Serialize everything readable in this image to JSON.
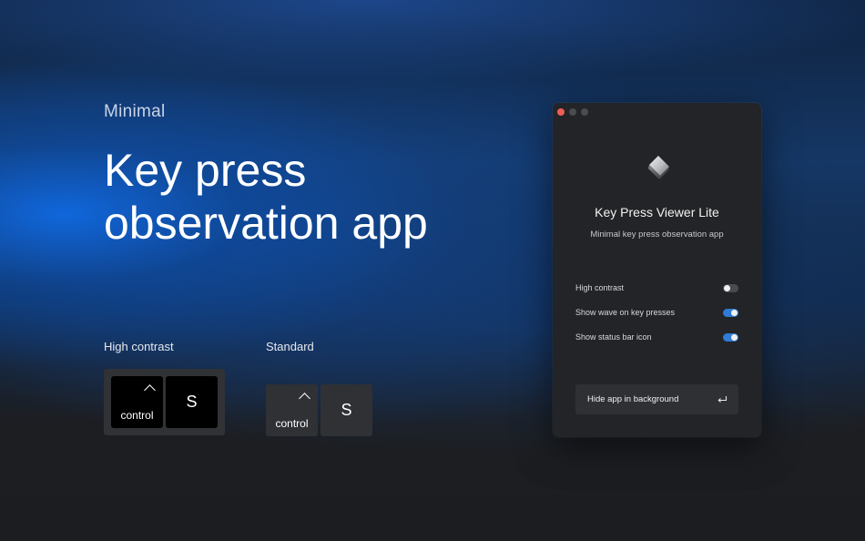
{
  "hero": {
    "subtitle": "Minimal",
    "headline_line1": "Key press",
    "headline_line2": "observation app"
  },
  "demo": {
    "high_contrast": {
      "label": "High contrast",
      "keys": [
        {
          "symbol": "^",
          "word": "control"
        },
        {
          "letter": "S"
        }
      ]
    },
    "standard": {
      "label": "Standard",
      "keys": [
        {
          "symbol": "^",
          "word": "control"
        },
        {
          "letter": "S"
        }
      ]
    }
  },
  "window": {
    "app_name": "Key Press Viewer Lite",
    "app_description": "Minimal key press observation app",
    "settings": [
      {
        "label": "High contrast",
        "enabled": false
      },
      {
        "label": "Show wave on key presses",
        "enabled": true
      },
      {
        "label": "Show status bar icon",
        "enabled": true
      }
    ],
    "hide_button_label": "Hide app in background",
    "hide_button_icon": "return-icon"
  },
  "colors": {
    "accent_blue": "#2f7bd6",
    "close_red": "#ec5f57",
    "window_bg": "#232427",
    "page_bg": "#1c1d20"
  }
}
